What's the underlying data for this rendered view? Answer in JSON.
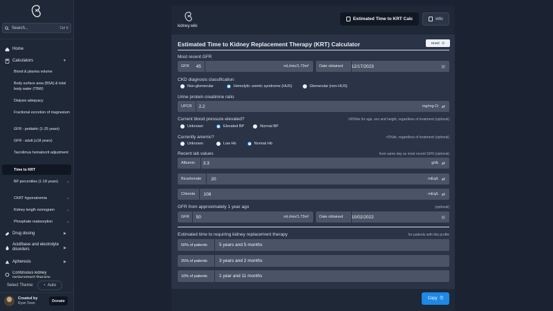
{
  "sidebar": {
    "search_placeholder": "Search...",
    "search_shortcut": "Ctrl K",
    "nav": {
      "home": "Home",
      "calculators": "Calculators",
      "drug_dosing": "Drug dosing",
      "acid_base": "Acid/base and electrolyte disorders",
      "apheresis": "Apheresis",
      "ckrt": "Continuous kidney replacement therapy"
    },
    "calculators_items": [
      "Blood & plasma volume",
      "Body surface area (BSA) & total body water (TBW)",
      "Dialysis adequacy",
      "Fractional excretion of magnesium",
      "GFR - pediatric (1-25 years)",
      "GFR - adult (≥18 years)",
      "Tacrolimus hematocrit adjustment",
      "Time to KRT",
      "BP percentiles (1-18 years)",
      "CKRT hyponatremia",
      "Kidney length nomogram",
      "Phosphate reabsorption"
    ],
    "theme_label": "Select Theme:",
    "theme_value": "Auto",
    "created_by": "Created by",
    "creator_name": "Ryan Town",
    "donate": "Donate"
  },
  "header": {
    "brand": "kidney.wiki",
    "primary_button": "Estimated Time to KRT Calc",
    "info_button": "info"
  },
  "calc": {
    "title": "Estimated Time to Kidney Replacement Therapy (KRT) Calculator",
    "reset": "reset",
    "gfr_recent_label": "Most recent GFR",
    "gfr_tag": "GFR",
    "gfr_recent_value": "45",
    "gfr_unit": "mL/min/1.73m²",
    "date_tag": "Date obtained",
    "gfr_recent_date": "12/17/2023",
    "ckd_label": "CKD diagnosis classification",
    "ckd_options": [
      "Non-glomerular",
      "Hemolytic uremic syndrome (HUS)",
      "Glomerular (non-HUS)"
    ],
    "upcr_label": "Urine protein creatinine ratio",
    "upcr_tag": "UPCR",
    "upcr_value": "2.2",
    "upcr_unit": "mg/mg Cr",
    "bp_label": "Current blood pressure elevated?",
    "bp_note": ">90%ile for age, sex and height, regardless of treatment (optional)",
    "bp_options": [
      "Unknown",
      "Elevated BP",
      "Normal BP"
    ],
    "anemic_label": "Currently anemic?",
    "anemic_note": "<5%ile, regardless of treatment (optional)",
    "anemic_options": [
      "Unknown",
      "Low Hb",
      "Normal Hb"
    ],
    "labs_label": "Recent lab values",
    "labs_note": "from same day as most recent GFR (optional)",
    "albumin_tag": "Albumin",
    "albumin_value": "3.3",
    "albumin_unit": "g/dL",
    "bicarb_tag": "Bicarbonate",
    "bicarb_value": "20",
    "bicarb_unit": "mEq/L",
    "chloride_tag": "Chloride",
    "chloride_value": "108",
    "chloride_unit": "mEq/L",
    "gfr_prior_label": "GFR from approximately 1 year ago",
    "gfr_prior_note": "(optional)",
    "gfr_prior_value": "50",
    "gfr_prior_date": "10/02/2022",
    "result_label": "Estimated time to requiring kidney replacement therapy",
    "result_note": "for patients with this profile",
    "results": [
      {
        "pct": "50% of patients",
        "value": "5 years and 5 months"
      },
      {
        "pct": "25% of patients",
        "value": "3 years and 2 months"
      },
      {
        "pct": "10% of patients",
        "value": "1 year and 11 months"
      }
    ],
    "copy": "Copy"
  },
  "colors": {
    "accent": "#1e88e5",
    "panel": "#2a3446",
    "field": "#4a5466",
    "background": "#1b2332"
  }
}
